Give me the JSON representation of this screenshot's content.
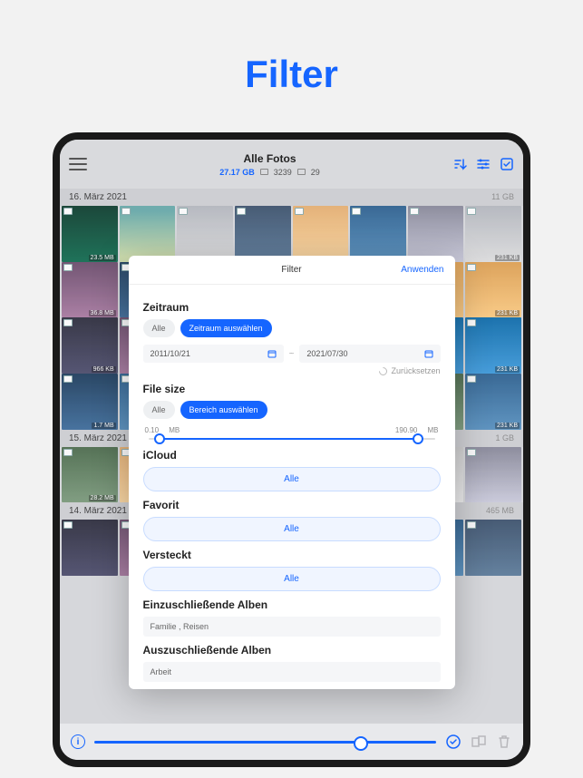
{
  "page_heading": "Filter",
  "header": {
    "title": "Alle Fotos",
    "storage": "27.17 GB",
    "photo_count": "3239",
    "video_count": "29"
  },
  "dates": {
    "d1": {
      "label": "16. März 2021",
      "size": "11 GB"
    },
    "d2": {
      "label": "15. März 2021",
      "size": "1 GB"
    },
    "d3": {
      "label": "14. März 2021",
      "size": "465 MB"
    }
  },
  "thumbs": {
    "s0": "23.5 MB",
    "s1": "231 KB",
    "s2": "36.8 MB",
    "s3": "231 KB",
    "s4": "966 KB",
    "s5": "231 KB",
    "s6": "1.7 MB",
    "s7": "231 KB",
    "s8": "28.2 MB"
  },
  "modal": {
    "title": "Filter",
    "apply": "Anwenden",
    "sections": {
      "zeitraum": {
        "title": "Zeitraum",
        "all": "Alle",
        "select": "Zeitraum auswählen",
        "from": "2011/10/21",
        "to": "2021/07/30",
        "reset": "Zurücksetzen"
      },
      "filesize": {
        "title": "File size",
        "all": "Alle",
        "select": "Bereich auswählen",
        "min_val": "0.10",
        "min_unit": "MB",
        "max_val": "190.90",
        "max_unit": "MB"
      },
      "icloud": {
        "title": "iCloud",
        "btn": "Alle"
      },
      "favorit": {
        "title": "Favorit",
        "btn": "Alle"
      },
      "versteckt": {
        "title": "Versteckt",
        "btn": "Alle"
      },
      "include": {
        "title": "Einzuschließende Alben",
        "value": "Familie , Reisen"
      },
      "exclude": {
        "title": "Auszuschließende Alben",
        "value": "Arbeit"
      }
    }
  }
}
